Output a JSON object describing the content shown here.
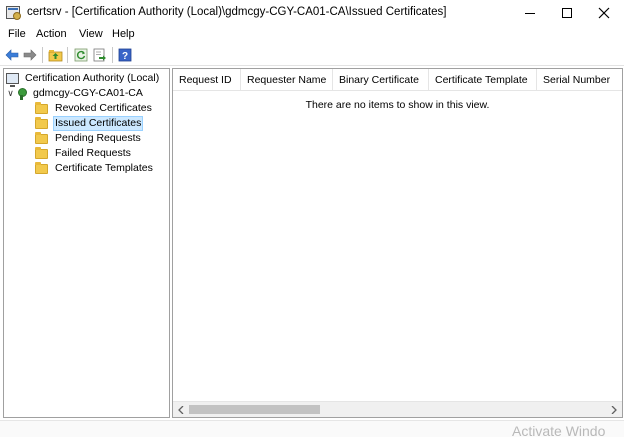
{
  "window": {
    "title": "certsrv - [Certification Authority (Local)\\gdmcgy-CGY-CA01-CA\\Issued Certificates]"
  },
  "menu": {
    "items": [
      "File",
      "Action",
      "View",
      "Help"
    ]
  },
  "toolbar": {
    "icons": [
      "back-arrow-icon",
      "forward-arrow-icon",
      "up-folder-icon",
      "refresh-icon",
      "export-list-icon",
      "help-icon"
    ]
  },
  "tree": {
    "root": "Certification Authority (Local)",
    "ca_node": "gdmcgy-CGY-CA01-CA",
    "children": [
      "Revoked Certificates",
      "Issued Certificates",
      "Pending Requests",
      "Failed Requests",
      "Certificate Templates"
    ],
    "selected": "Issued Certificates"
  },
  "list": {
    "columns": [
      "Request ID",
      "Requester Name",
      "Binary Certificate",
      "Certificate Template",
      "Serial Number"
    ],
    "empty_message": "There are no items to show in this view."
  },
  "watermark": "Activate Windo",
  "colors": {
    "selection_bg": "#cce8ff",
    "selection_border": "#99d1ff",
    "folder": "#f2c94c"
  }
}
